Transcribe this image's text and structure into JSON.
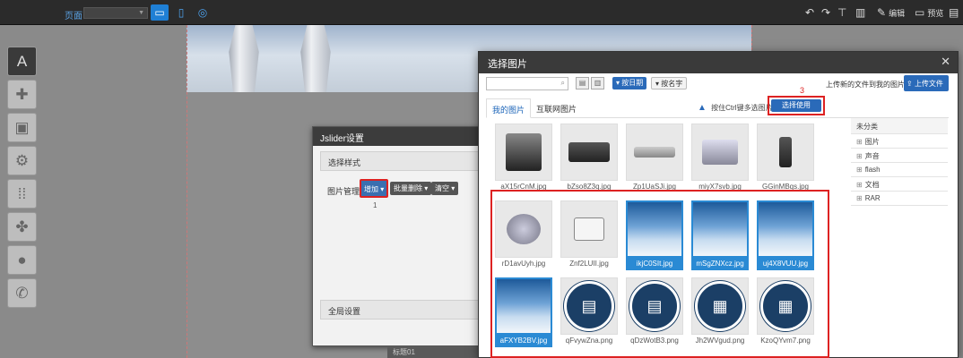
{
  "topbar": {
    "page_label": "页面",
    "page_select": "",
    "edit_label": "编辑",
    "preview_label": "预览"
  },
  "jslider": {
    "title": "Jslider设置",
    "select_style": "选择样式",
    "image_manage": "图片管理",
    "add_button": "增加",
    "batch_delete_button": "批量删除",
    "clear_button": "清空",
    "step1": "1",
    "global_settings": "全局设置"
  },
  "canvas": {
    "label": "标题01"
  },
  "dialog": {
    "title": "选择图片",
    "search_placeholder": "",
    "sort_by_date": "按日期",
    "sort_by_name": "按名字",
    "upload_hint": "上传新的文件到我的图片",
    "upload_button": "上传文件",
    "tabs": [
      "我的图片",
      "互联网图片"
    ],
    "ctrl_hint": "按住Ctrl键多选图片",
    "use_button": "选择使用",
    "step3": "3",
    "categories_head": "未分类",
    "categories": [
      "图片",
      "声音",
      "flash",
      "文档",
      "RAR"
    ],
    "files": [
      "aX15rCnM.jpg",
      "bZso8Z3q.jpg",
      "Zp1UaSJi.jpg",
      "miyX7svb.jpg",
      "GGinMBqs.jpg",
      "rD1avUyh.jpg",
      "Znf2LUII.jpg",
      "ikjC0SIt.jpg",
      "mSgZNXcz.jpg",
      "uj4X8VUU.jpg",
      "aFXYB2BV.jpg",
      "qFvywZna.png",
      "qDzWotB3.png",
      "Jh2WVgud.png",
      "KzoQYvm7.png"
    ]
  }
}
